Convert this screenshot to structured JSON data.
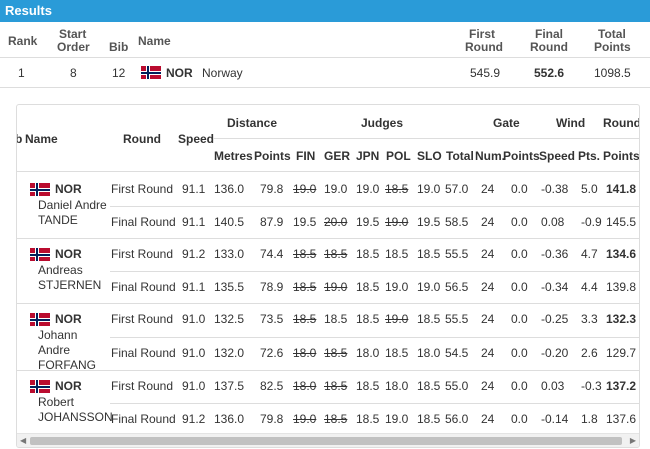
{
  "title": "Results",
  "summary": {
    "headers": {
      "rank": "Rank",
      "start_order_1": "Start",
      "start_order_2": "Order",
      "bib": "Bib",
      "name": "Name",
      "first_round_1": "First",
      "first_round_2": "Round",
      "final_round_1": "Final",
      "final_round_2": "Round",
      "total_points_1": "Total",
      "total_points_2": "Points"
    },
    "row": {
      "rank": "1",
      "start_order": "8",
      "bib": "12",
      "country_code": "NOR",
      "country": "Norway",
      "first_round": "545.9",
      "final_round": "552.6",
      "total_points": "1098.5"
    }
  },
  "detail": {
    "headers": {
      "bib": "b",
      "name": "Name",
      "round": "Round",
      "speed": "Speed",
      "distance": "Distance",
      "metres": "Metres",
      "points": "Points",
      "judges": "Judges",
      "fin": "FIN",
      "ger": "GER",
      "jpn": "JPN",
      "pol": "POL",
      "slo": "SLO",
      "total": "Total",
      "gate": "Gate",
      "num": "Num.",
      "gate_points": "Points",
      "wind": "Wind",
      "wind_speed": "Speed",
      "pts": "Pts.",
      "round_group": "Round",
      "round_points": "Points"
    },
    "athletes": [
      {
        "code": "NOR",
        "name_lines": [
          "Daniel Andre",
          "TANDE"
        ],
        "rounds": [
          {
            "round": "First Round",
            "speed": "91.1",
            "metres": "136.0",
            "points": "79.8",
            "fin": "19.0",
            "ger": "19.0",
            "jpn": "19.0",
            "pol": "18.5",
            "slo": "19.0",
            "total": "57.0",
            "num": "24",
            "gate_pts": "0.0",
            "wind_speed": "-0.38",
            "wind_pts": "5.0",
            "round_pts": "141.8"
          },
          {
            "round": "Final Round",
            "speed": "91.1",
            "metres": "140.5",
            "points": "87.9",
            "fin": "19.5",
            "ger": "20.0",
            "jpn": "19.5",
            "pol": "19.0",
            "slo": "19.5",
            "total": "58.5",
            "num": "24",
            "gate_pts": "0.0",
            "wind_speed": "0.08",
            "wind_pts": "-0.9",
            "round_pts": "145.5"
          }
        ]
      },
      {
        "code": "NOR",
        "name_lines": [
          "Andreas",
          "STJERNEN"
        ],
        "rounds": [
          {
            "round": "First Round",
            "speed": "91.2",
            "metres": "133.0",
            "points": "74.4",
            "fin": "18.5",
            "ger": "18.5",
            "jpn": "18.5",
            "pol": "18.5",
            "slo": "18.5",
            "total": "55.5",
            "num": "24",
            "gate_pts": "0.0",
            "wind_speed": "-0.36",
            "wind_pts": "4.7",
            "round_pts": "134.6"
          },
          {
            "round": "Final Round",
            "speed": "91.1",
            "metres": "135.5",
            "points": "78.9",
            "fin": "18.5",
            "ger": "19.0",
            "jpn": "18.5",
            "pol": "19.0",
            "slo": "19.0",
            "total": "56.5",
            "num": "24",
            "gate_pts": "0.0",
            "wind_speed": "-0.34",
            "wind_pts": "4.4",
            "round_pts": "139.8"
          }
        ]
      },
      {
        "code": "NOR",
        "name_lines": [
          "Johann",
          "Andre",
          "FORFANG"
        ],
        "rounds": [
          {
            "round": "First Round",
            "speed": "91.0",
            "metres": "132.5",
            "points": "73.5",
            "fin": "18.5",
            "ger": "18.5",
            "jpn": "18.5",
            "pol": "19.0",
            "slo": "18.5",
            "total": "55.5",
            "num": "24",
            "gate_pts": "0.0",
            "wind_speed": "-0.25",
            "wind_pts": "3.3",
            "round_pts": "132.3"
          },
          {
            "round": "Final Round",
            "speed": "91.0",
            "metres": "132.0",
            "points": "72.6",
            "fin": "18.0",
            "ger": "18.5",
            "jpn": "18.0",
            "pol": "18.5",
            "slo": "18.0",
            "total": "54.5",
            "num": "24",
            "gate_pts": "0.0",
            "wind_speed": "-0.20",
            "wind_pts": "2.6",
            "round_pts": "129.7"
          }
        ]
      },
      {
        "code": "NOR",
        "name_lines": [
          "Robert",
          "JOHANSSON"
        ],
        "rounds": [
          {
            "round": "First Round",
            "speed": "91.0",
            "metres": "137.5",
            "points": "82.5",
            "fin": "18.0",
            "ger": "18.5",
            "jpn": "18.5",
            "pol": "18.0",
            "slo": "18.5",
            "total": "55.0",
            "num": "24",
            "gate_pts": "0.0",
            "wind_speed": "0.03",
            "wind_pts": "-0.3",
            "round_pts": "137.2"
          },
          {
            "round": "Final Round",
            "speed": "91.2",
            "metres": "136.0",
            "points": "79.8",
            "fin": "19.0",
            "ger": "18.5",
            "jpn": "18.5",
            "pol": "19.0",
            "slo": "18.5",
            "total": "56.0",
            "num": "24",
            "gate_pts": "0.0",
            "wind_speed": "-0.14",
            "wind_pts": "1.8",
            "round_pts": "137.6"
          }
        ]
      }
    ]
  }
}
